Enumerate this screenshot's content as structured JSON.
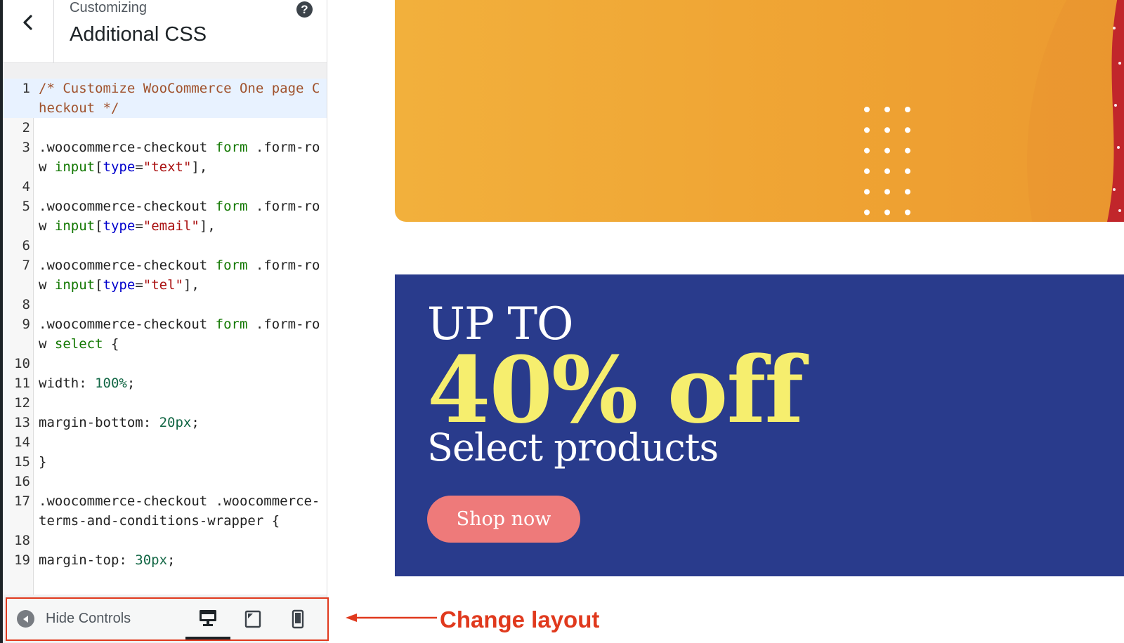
{
  "sidebar": {
    "header": {
      "back_icon": "chevron-left-icon",
      "subtitle": "Customizing",
      "title": "Additional CSS",
      "help_icon": "question-mark-icon",
      "help_label": "?"
    },
    "code_lines": [
      [
        {
          "t": "/* Customize WooCommerce One page Checkout */",
          "c": "comment"
        }
      ],
      [],
      [
        {
          "t": ".woocommerce-checkout "
        },
        {
          "t": "form",
          "c": "tag"
        },
        {
          "t": " .form-row "
        },
        {
          "t": "input",
          "c": "tag"
        },
        {
          "t": "["
        },
        {
          "t": "type",
          "c": "attr"
        },
        {
          "t": "="
        },
        {
          "t": "\"text\"",
          "c": "str"
        },
        {
          "t": "],"
        }
      ],
      [],
      [
        {
          "t": ".woocommerce-checkout "
        },
        {
          "t": "form",
          "c": "tag"
        },
        {
          "t": " .form-row "
        },
        {
          "t": "input",
          "c": "tag"
        },
        {
          "t": "["
        },
        {
          "t": "type",
          "c": "attr"
        },
        {
          "t": "="
        },
        {
          "t": "\"email\"",
          "c": "str"
        },
        {
          "t": "],"
        }
      ],
      [],
      [
        {
          "t": ".woocommerce-checkout "
        },
        {
          "t": "form",
          "c": "tag"
        },
        {
          "t": " .form-row "
        },
        {
          "t": "input",
          "c": "tag"
        },
        {
          "t": "["
        },
        {
          "t": "type",
          "c": "attr"
        },
        {
          "t": "="
        },
        {
          "t": "\"tel\"",
          "c": "str"
        },
        {
          "t": "],"
        }
      ],
      [],
      [
        {
          "t": ".woocommerce-checkout "
        },
        {
          "t": "form",
          "c": "tag"
        },
        {
          "t": " .form-row "
        },
        {
          "t": "select",
          "c": "tag"
        },
        {
          "t": " {"
        }
      ],
      [],
      [
        {
          "t": "width: "
        },
        {
          "t": "100%",
          "c": "num"
        },
        {
          "t": ";"
        }
      ],
      [],
      [
        {
          "t": "margin-bottom: "
        },
        {
          "t": "20px",
          "c": "num"
        },
        {
          "t": ";"
        }
      ],
      [],
      [
        {
          "t": "}"
        }
      ],
      [],
      [
        {
          "t": ".woocommerce-checkout .woocommerce-terms-and-conditions-wrapper {"
        }
      ],
      [],
      [
        {
          "t": "margin-top: "
        },
        {
          "t": "30px",
          "c": "num"
        },
        {
          "t": ";"
        }
      ]
    ],
    "active_line": 1,
    "footer": {
      "hide_label": "Hide Controls",
      "hide_icon": "arrow-left-circle-icon",
      "devices": [
        {
          "name": "desktop",
          "icon": "desktop-icon",
          "active": true
        },
        {
          "name": "tablet",
          "icon": "tablet-icon",
          "active": false
        },
        {
          "name": "mobile",
          "icon": "mobile-icon",
          "active": false
        }
      ]
    }
  },
  "annotation": {
    "text": "Change layout",
    "color": "#e0391d"
  },
  "preview": {
    "promo": {
      "line1": "UP TO",
      "line2": "40% off",
      "line3": "Select products",
      "button": "Shop now"
    },
    "colors": {
      "orange_banner": "#f0a936",
      "blue_banner": "#293b8c",
      "discount_text": "#f6ee6e",
      "button_bg": "#ee7a7a"
    }
  }
}
